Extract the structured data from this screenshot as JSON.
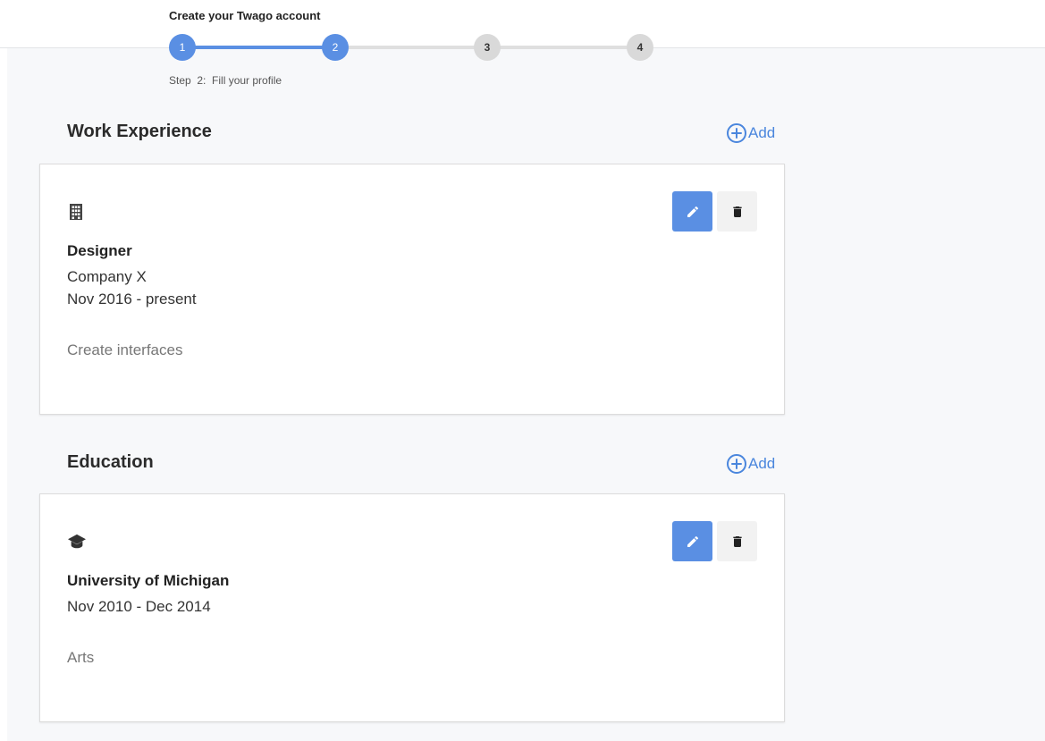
{
  "header": {
    "title": "Create your Twago account"
  },
  "stepper": {
    "steps": [
      {
        "number": "1",
        "state": "done"
      },
      {
        "number": "2",
        "state": "current"
      },
      {
        "number": "3",
        "state": "todo"
      },
      {
        "number": "4",
        "state": "todo"
      }
    ],
    "caption": "Step  2:  Fill your profile"
  },
  "work": {
    "section_title": "Work Experience",
    "add_label": "Add",
    "entry": {
      "icon": "building-icon",
      "title": "Designer",
      "company": "Company X",
      "period": "Nov 2016 - present",
      "description": "Create interfaces"
    }
  },
  "education": {
    "section_title": "Education",
    "add_label": "Add",
    "entry": {
      "icon": "graduation-cap-icon",
      "title": "University of Michigan",
      "period": "Nov 2010 - Dec 2014",
      "description": "Arts"
    }
  },
  "colors": {
    "accent": "#5a8fe3",
    "link": "#4a86dd",
    "inactive_step": "#d9d9d9",
    "page_background": "#f7f8fa"
  }
}
